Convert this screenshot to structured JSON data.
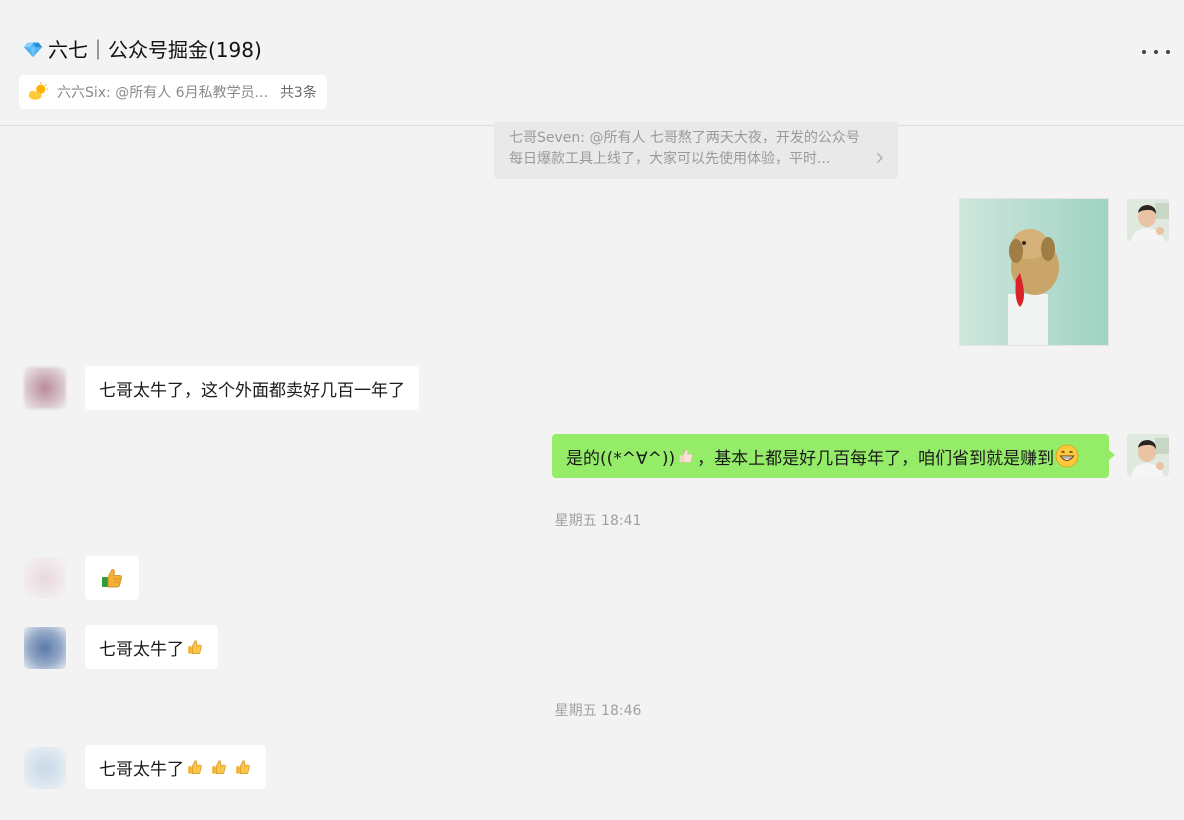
{
  "window": {
    "title": "六七｜公众号掘金(198)",
    "controls": [
      "minimize-icon",
      "maximize-icon",
      "close-icon"
    ]
  },
  "pinned": {
    "text": "六六Six: @所有人 6月私教学员...",
    "count": "共3条"
  },
  "quote": {
    "text": "七哥Seven: @所有人 七哥熬了两天大夜，开发的公众号每日爆款工具上线了，大家可以先使用体验，平时..."
  },
  "messages": [
    {
      "side": "in",
      "text": "七哥太牛了，这个外面都卖好几百一年了"
    },
    {
      "side": "out",
      "text_before": "是的((*^∀^))",
      "text_after": "，基本上都是好几百每年了，咱们省到就是赚到"
    },
    {
      "side": "in",
      "text": ""
    },
    {
      "side": "in",
      "text": "七哥太牛了"
    },
    {
      "side": "in",
      "text": "七哥太牛了"
    }
  ],
  "times": [
    "星期五 18:41",
    "星期五 18:46"
  ],
  "colors": {
    "background": "#f3f3f3",
    "bubble_in": "#ffffff",
    "bubble_out": "#95ec69",
    "quote_bg": "#e9e9e9"
  }
}
